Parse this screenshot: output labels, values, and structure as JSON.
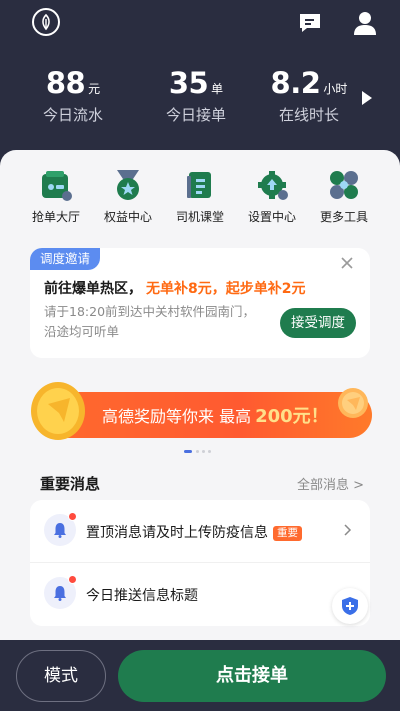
{
  "header": {
    "stats": [
      {
        "value": "88",
        "unit": "元",
        "label": "今日流水"
      },
      {
        "value": "35",
        "unit": "单",
        "label": "今日接单"
      },
      {
        "value": "8.2",
        "unit": "小时",
        "label": "在线时长"
      }
    ]
  },
  "tools": [
    {
      "label": "抢单大厅",
      "icon": "order-hall-icon"
    },
    {
      "label": "权益中心",
      "icon": "medal-icon"
    },
    {
      "label": "司机课堂",
      "icon": "book-icon"
    },
    {
      "label": "设置中心",
      "icon": "settings-gear-icon"
    },
    {
      "label": "更多工具",
      "icon": "more-tools-icon"
    }
  ],
  "dispatch": {
    "tag": "调度邀请",
    "title": "前往爆单热区，",
    "bonus": "无单补8元，起步单补2元",
    "desc": "请于18:20前到达中关村软件园南门，沿途均可听单",
    "button": "接受调度"
  },
  "banner": {
    "text": "高德奖励等你来 最高",
    "amount": "200元！"
  },
  "news": {
    "title": "重要消息",
    "all": "全部消息 >",
    "items": [
      {
        "text": "置顶消息请及时上传防疫信息",
        "badge": "重要"
      },
      {
        "text": "今日推送信息标题",
        "badge": ""
      }
    ]
  },
  "bottom": {
    "mode": "模式",
    "accept": "点击接单"
  },
  "colors": {
    "dark_bg": "#2a2d40",
    "brand_green": "#1f7c4e",
    "accent_orange": "#ff6a2e",
    "tag_blue": "#5c8cf0"
  }
}
